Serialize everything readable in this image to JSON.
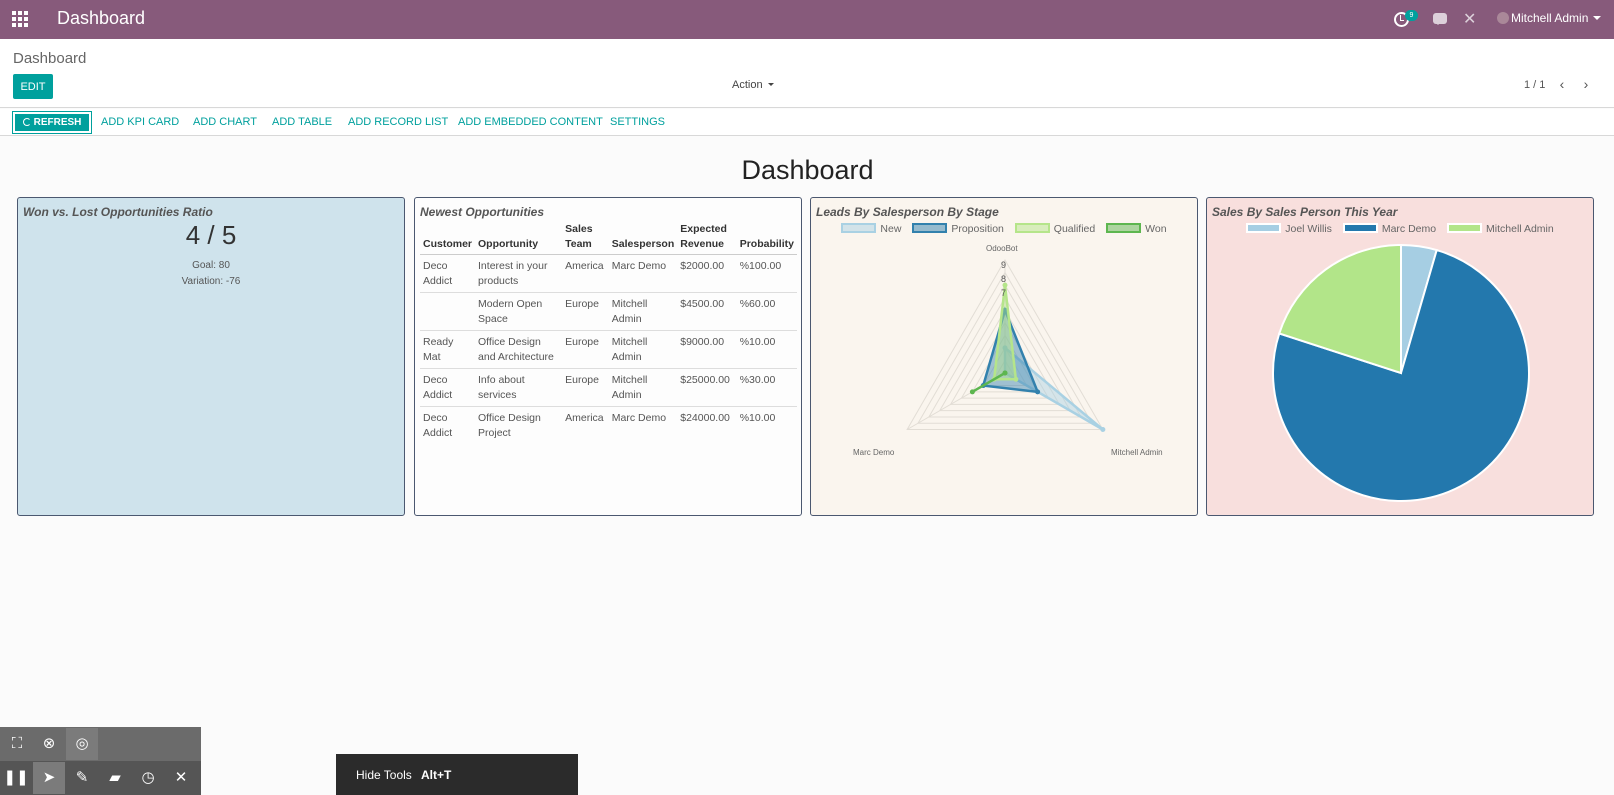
{
  "header": {
    "app_title": "Dashboard",
    "activity_count": "9",
    "user_name": "Mitchell Admin"
  },
  "control_panel": {
    "breadcrumb": "Dashboard",
    "edit_label": "EDIT",
    "action_label": "Action",
    "pager": "1 / 1"
  },
  "toolbar": {
    "refresh_label": "REFRESH",
    "links": [
      "ADD KPI CARD",
      "ADD CHART",
      "ADD TABLE",
      "ADD RECORD LIST",
      "ADD EMBEDDED CONTENT",
      "SETTINGS"
    ]
  },
  "dashboard": {
    "title": "Dashboard",
    "kpi": {
      "title": "Won vs. Lost Opportunities Ratio",
      "value": "4 / 5",
      "goal": "Goal: 80",
      "variation": "Variation: -76"
    },
    "opportunities": {
      "title": "Newest Opportunities",
      "columns": [
        "Customer",
        "Opportunity",
        "Sales Team",
        "Salesperson",
        "Expected Revenue",
        "Probability"
      ],
      "rows": [
        [
          "Deco Addict",
          "Interest in your products",
          "America",
          "Marc Demo",
          "$2000.00",
          "%100.00"
        ],
        [
          "",
          "Modern Open Space",
          "Europe",
          "Mitchell Admin",
          "$4500.00",
          "%60.00"
        ],
        [
          "Ready Mat",
          "Office Design and Architecture",
          "Europe",
          "Mitchell Admin",
          "$9000.00",
          "%10.00"
        ],
        [
          "Deco Addict",
          "Info about services",
          "Europe",
          "Mitchell Admin",
          "$25000.00",
          "%30.00"
        ],
        [
          "Deco Addict",
          "Office Design Project",
          "America",
          "Marc Demo",
          "$24000.00",
          "%10.00"
        ]
      ]
    },
    "radar": {
      "title": "Leads By Salesperson By Stage",
      "ticks": [
        "9",
        "8",
        "7"
      ]
    },
    "pie": {
      "title": "Sales By Sales Person This Year"
    }
  },
  "chart_data": [
    {
      "type": "radar",
      "title": "Leads By Salesperson By Stage",
      "categories": [
        "OdooBot",
        "Mitchell Admin",
        "Marc Demo"
      ],
      "rmax": 9,
      "series": [
        {
          "name": "New",
          "color": "#a9d1e3",
          "values": [
            2,
            9,
            0
          ]
        },
        {
          "name": "Proposition",
          "color": "#3281ad",
          "values": [
            5,
            3,
            2
          ]
        },
        {
          "name": "Qualified",
          "color": "#b5e58a",
          "values": [
            7,
            1,
            1
          ]
        },
        {
          "name": "Won",
          "color": "#5db64f",
          "values": [
            0,
            0,
            3
          ]
        }
      ]
    },
    {
      "type": "pie",
      "title": "Sales By Sales Person This Year",
      "labels": [
        "Joel Willis",
        "Marc Demo",
        "Mitchell Admin"
      ],
      "values": [
        4.5,
        75.5,
        20
      ],
      "colors": [
        "#a6cee3",
        "#2378ad",
        "#b2e589"
      ]
    }
  ],
  "screen_tools": {
    "hide_label": "Hide Tools",
    "hide_shortcut": "Alt+T"
  }
}
